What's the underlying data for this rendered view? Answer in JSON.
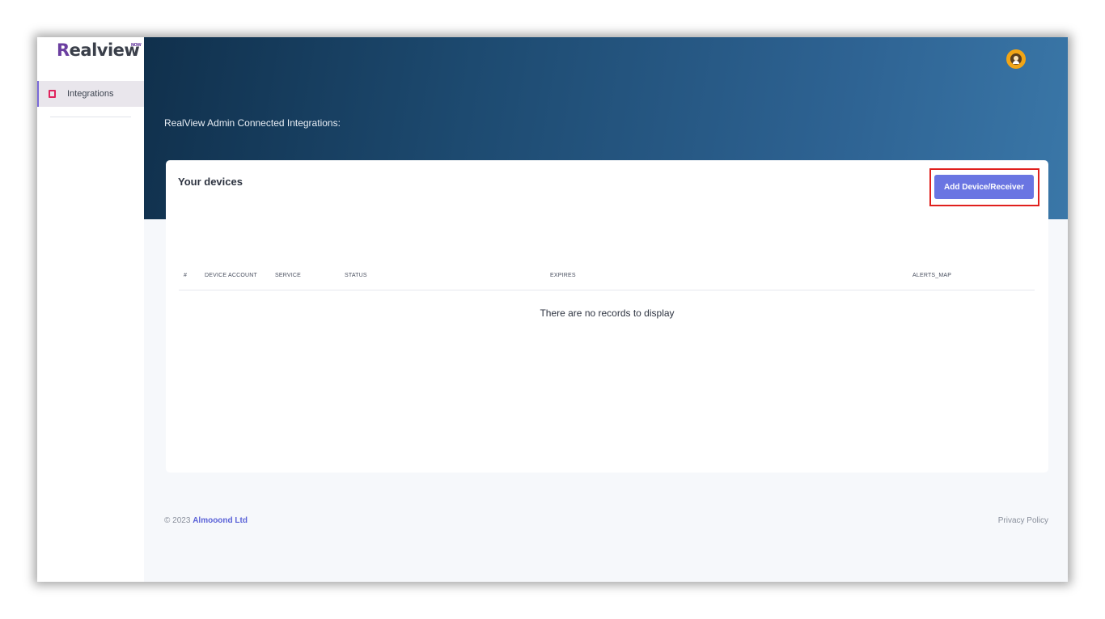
{
  "brand": {
    "logo_text": "ealview",
    "logo_initial": "R",
    "logo_tag": "NOW"
  },
  "sidebar": {
    "items": [
      {
        "label": "Integrations",
        "icon": "tablet-icon"
      }
    ]
  },
  "header": {
    "title": "RealView Admin Connected Integrations:",
    "avatar_icon": "user-avatar-icon"
  },
  "card": {
    "title": "Your devices",
    "add_button_label": "Add Device/Receiver",
    "columns": [
      "#",
      "DEVICE ACCOUNT",
      "SERVICE",
      "STATUS",
      "EXPIRES",
      "ALERTS_MAP"
    ],
    "empty_message": "There are no records to display"
  },
  "footer": {
    "copyright": "© 2023",
    "company": "Almooond Ltd",
    "privacy": "Privacy Policy"
  },
  "colors": {
    "accent": "#6a75e2",
    "highlight": "#e0201d",
    "nav_icon": "#e0245e"
  }
}
